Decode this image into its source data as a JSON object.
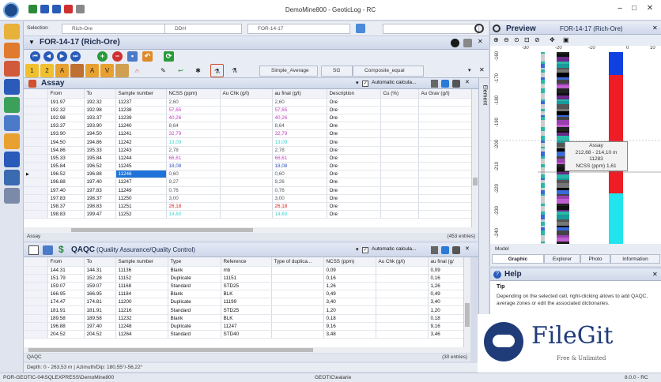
{
  "window": {
    "title": "DemoMine800 - GeoticLog - RC"
  },
  "selection": {
    "label": "Selection",
    "combo1": "Rich-Ore",
    "combo2": "DDH",
    "combo3": "FOR-14-17"
  },
  "drillhole": {
    "title": "FOR-14-17 (Rich-Ore)"
  },
  "tabs": {
    "t1": "Simple_Average",
    "t2": "SG",
    "t3": "Composite_equal"
  },
  "element_tab": "Element",
  "assay": {
    "title": "Assay",
    "auto_label": "Automatic calcula...",
    "columns": [
      "From",
      "To",
      "Sample number",
      "NCSS (ppm)",
      "Au Chk (g/t)",
      "au final (g/t)",
      "Description",
      "Cu (%)",
      "Au Grav (g/t)"
    ],
    "rows": [
      [
        "191.97",
        "192.32",
        "11237",
        "2,60",
        "",
        "2,60",
        "Ore",
        "",
        ""
      ],
      [
        "192.32",
        "192.98",
        "11238",
        "57,65",
        "",
        "57,65",
        "Ore",
        "",
        ""
      ],
      [
        "192.98",
        "193.37",
        "11239",
        "40,26",
        "",
        "40,26",
        "Ore",
        "",
        ""
      ],
      [
        "193.37",
        "193.90",
        "11240",
        "8,64",
        "",
        "8,64",
        "Ore",
        "",
        ""
      ],
      [
        "193.90",
        "194.50",
        "11241",
        "32,79",
        "",
        "32,79",
        "Ore",
        "",
        ""
      ],
      [
        "194.50",
        "194.86",
        "11242",
        "13,09",
        "",
        "13,09",
        "Ore",
        "",
        ""
      ],
      [
        "194.86",
        "195.33",
        "11243",
        "2,78",
        "",
        "2,78",
        "Ore",
        "",
        ""
      ],
      [
        "195.33",
        "195.84",
        "11244",
        "66,61",
        "",
        "66,61",
        "Ore",
        "",
        ""
      ],
      [
        "195.84",
        "196.52",
        "11245",
        "18,08",
        "",
        "18,08",
        "Ore",
        "",
        ""
      ],
      [
        "196.52",
        "196.88",
        "11246",
        "0,60",
        "",
        "0,60",
        "Ore",
        "",
        ""
      ],
      [
        "196.88",
        "197.40",
        "11247",
        "9,27",
        "",
        "9,26",
        "Ore",
        "",
        ""
      ],
      [
        "197.40",
        "197.83",
        "11249",
        "0,76",
        "",
        "0,76",
        "Ore",
        "",
        ""
      ],
      [
        "197.83",
        "198.37",
        "11250",
        "3,00",
        "",
        "3,00",
        "Ore",
        "",
        ""
      ],
      [
        "198.37",
        "198.83",
        "11251",
        "26,18",
        "",
        "26,18",
        "Ore",
        "",
        ""
      ],
      [
        "198.83",
        "199.47",
        "11252",
        "14,60",
        "",
        "14,60",
        "Ore",
        "",
        ""
      ]
    ],
    "colors": [
      "#555",
      "#c040c0",
      "#c040c0",
      "#555",
      "#c040c0",
      "#40d0d0",
      "#555",
      "#c040c0",
      "#3050c0",
      "#555",
      "#555",
      "#555",
      "#555",
      "#d02020",
      "#40d0d0"
    ],
    "status_left": "Assay",
    "status_right": "(453 entries)"
  },
  "qaqc": {
    "title": "QAQC",
    "subtitle": "(Quality Assurance/Quality Control)",
    "auto_label": "Automatic calcula...",
    "columns": [
      "From",
      "To",
      "Sample number",
      "Type",
      "Reference",
      "Type of duplica...",
      "NCSS (ppm)",
      "Au Chk (g/t)",
      "au final (g/"
    ],
    "rows": [
      [
        "144.31",
        "144.31",
        "11136",
        "Blank",
        "mb",
        "",
        "0,09",
        "",
        "0,09"
      ],
      [
        "151.79",
        "152.28",
        "11152",
        "Duplicate",
        "11151",
        "",
        "0,16",
        "",
        "0,16"
      ],
      [
        "159.07",
        "159.07",
        "11168",
        "Standard",
        "STD25",
        "",
        "1,26",
        "",
        "1,26"
      ],
      [
        "166.95",
        "166.95",
        "11184",
        "Blank",
        "BLK",
        "",
        "0,49",
        "",
        "0,49"
      ],
      [
        "174.47",
        "174.81",
        "11200",
        "Duplicate",
        "11199",
        "",
        "3,40",
        "",
        "3,40"
      ],
      [
        "181.91",
        "181.91",
        "11216",
        "Standard",
        "STD25",
        "",
        "1,20",
        "",
        "1,20"
      ],
      [
        "189.58",
        "189.58",
        "11232",
        "Blank",
        "BLK",
        "",
        "0,18",
        "",
        "0,18"
      ],
      [
        "196.88",
        "197.40",
        "11248",
        "Duplicate",
        "11247",
        "",
        "9,16",
        "",
        "9,16"
      ],
      [
        "204.52",
        "204.52",
        "11264",
        "Standard",
        "STD40",
        "",
        "3,48",
        "",
        "3,46"
      ]
    ],
    "status_left": "QAQC",
    "status_right": "(30 entries)"
  },
  "depth_bar": "Depth: 0 - 263,53 m  |  Azimuth/Dip: 180,55°/-56,22°",
  "preview": {
    "title": "Preview",
    "hole": "FOR-14-17 (Rich-Ore)",
    "x_ticks": [
      "-30",
      "-20",
      "-10",
      "0",
      "10"
    ],
    "depth_ticks": [
      "-160",
      "-170",
      "-180",
      "-190",
      "-200",
      "-210",
      "-220",
      "-230",
      "-240"
    ],
    "tooltip": {
      "title": "Assay",
      "range": "212,68  -  214,10 m",
      "sample": "11283",
      "value": "NCSS (ppm)  1,61"
    },
    "model_label": "Model",
    "tabs": [
      "Graphic",
      "Explorer",
      "Photo",
      "Information"
    ]
  },
  "help": {
    "title": "Help",
    "tip_label": "Tip",
    "text": "Depending on the selected cell, right-clicking allows to add QAQC, average zones or edit the associated dictionaries."
  },
  "bottom": {
    "left": "POR-GEOTIC-04\\SQLEXPRESS\\DemoMine800",
    "mid": "GEOTIC\\ealarie",
    "right": "8.0.0 - RC"
  },
  "watermark": {
    "name": "FileGit",
    "tagline": "Free & Unlimited"
  }
}
